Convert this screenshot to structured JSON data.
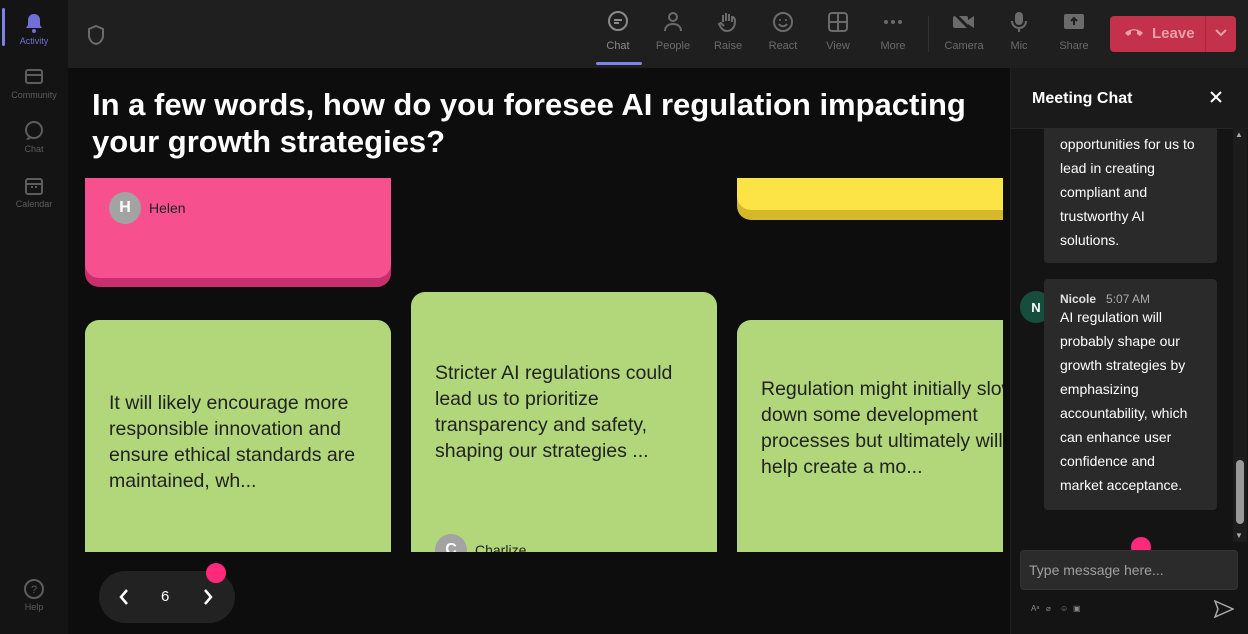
{
  "rail": {
    "items": [
      {
        "label": "Activity",
        "icon": "bell-icon",
        "active": true
      },
      {
        "label": "Community",
        "icon": "community-icon"
      },
      {
        "label": "Chat",
        "icon": "chat-icon"
      },
      {
        "label": "Calendar",
        "icon": "calendar-icon"
      },
      {
        "label": "Help",
        "icon": "help-icon"
      }
    ]
  },
  "toolbar": {
    "chat": "Chat",
    "people": "People",
    "raise": "Raise",
    "react": "React",
    "view": "View",
    "more": "More",
    "camera": "Camera",
    "mic": "Mic",
    "share": "Share",
    "leave": "Leave"
  },
  "question": "In a few words, how do you foresee AI regulation impacting your growth strategies?",
  "cards": {
    "pink": {
      "author": "Helen",
      "initial": "H",
      "color": "#f6508f"
    },
    "yellow": {
      "color": "#fce447"
    },
    "green1": {
      "text": "It will likely encourage more responsible innovation and ensure ethical standards are maintained, wh..."
    },
    "green2": {
      "text": "Stricter AI regulations could lead us to prioritize transparency and safety, shaping our strategies ...",
      "author": "Charlize",
      "initial": "C"
    },
    "green3": {
      "text": "Regulation might initially slow down some development processes but ultimately will help create a mo..."
    }
  },
  "pager": {
    "page": "6"
  },
  "chat": {
    "title": "Meeting Chat",
    "prev_message": "opportunities for us to lead in creating compliant and trustworthy AI solutions.",
    "message": {
      "author": "Nicole",
      "initial": "N",
      "time": "5:07 AM",
      "text": "AI regulation will probably shape our growth strategies by emphasizing accountability, which can enhance user confidence and market acceptance."
    },
    "input_placeholder": "Type message here..."
  },
  "colors": {
    "accent": "#7b83eb",
    "leave": "#c4314b",
    "card_green": "#b1d77a",
    "notification_dot": "#ff2a7a"
  }
}
